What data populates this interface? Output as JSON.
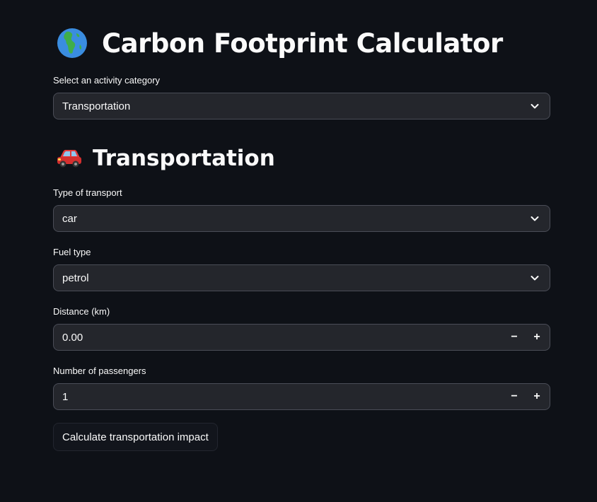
{
  "header": {
    "title": "Carbon Footprint Calculator",
    "title_icon": "globe-africa-emoji"
  },
  "category": {
    "label": "Select an activity category",
    "value": "Transportation"
  },
  "section": {
    "title": "Transportation",
    "icon": "car-emoji"
  },
  "fields": {
    "transport_type": {
      "label": "Type of transport",
      "value": "car"
    },
    "fuel_type": {
      "label": "Fuel type",
      "value": "petrol"
    },
    "distance": {
      "label": "Distance (km)",
      "value": "0.00",
      "minus": "−",
      "plus": "+"
    },
    "passengers": {
      "label": "Number of passengers",
      "value": "1",
      "minus": "−",
      "plus": "+"
    }
  },
  "actions": {
    "calculate_label": "Calculate transportation impact"
  },
  "colors": {
    "background": "#0e1117",
    "input_bg": "#24262c",
    "text": "#fafafa"
  }
}
